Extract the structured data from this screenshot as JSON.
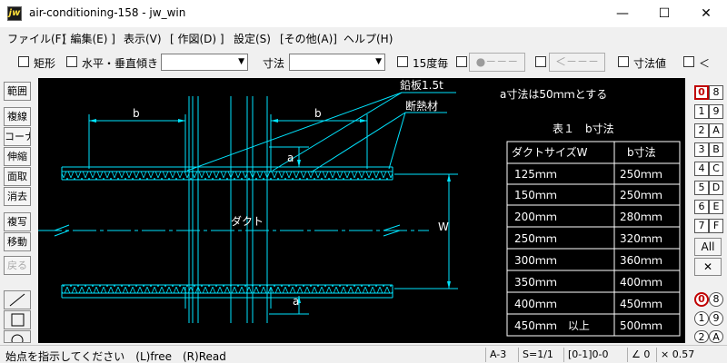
{
  "window": {
    "app_icon": "jw",
    "title": "air-conditioning-158 - jw_win",
    "minimize": "—",
    "maximize": "☐",
    "close": "✕"
  },
  "menu": [
    "ファイル(F)",
    "[ 編集(E) ]",
    "表示(V)",
    "[ 作図(D) ]",
    "設定(S)",
    "[その他(A)]",
    "ヘルプ(H)"
  ],
  "toolbar": {
    "rect": "矩形",
    "hv": "水平・垂直",
    "tilt": "傾き",
    "tilt_value": "",
    "dim": "寸法",
    "dim_value": "",
    "deg15": "15度毎",
    "pt_btn": "●－－－",
    "arrow_btn": "＜－－－",
    "dimval": "寸法値",
    "lt": "＜"
  },
  "left_tools": {
    "items": [
      "範囲",
      "複線",
      "コーナー",
      "伸縮",
      "面取",
      "消去",
      "複写",
      "移動",
      "戻る"
    ],
    "line_icon": "diagonal-line-icon",
    "rect_icon": "rectangle-icon",
    "circle_icon": "circle-icon"
  },
  "layers": {
    "rows": [
      [
        "0",
        "8"
      ],
      [
        "1",
        "9"
      ],
      [
        "2",
        "A"
      ],
      [
        "3",
        "B"
      ],
      [
        "4",
        "C"
      ],
      [
        "5",
        "D"
      ],
      [
        "6",
        "E"
      ],
      [
        "7",
        "F"
      ]
    ],
    "all": "All",
    "x": "✕",
    "groups": [
      [
        "0",
        "8"
      ],
      [
        "1",
        "9"
      ],
      [
        "2",
        "A"
      ]
    ]
  },
  "drawing": {
    "label_lead": "鉛板1.5t",
    "label_insul": "断熱材",
    "note": "a寸法は50ｍｍとする",
    "dim_b1": "b",
    "dim_b2": "b",
    "dim_a1": "a",
    "dim_a2": "a",
    "dim_w": "W",
    "duct": "ダクト"
  },
  "table": {
    "title": "表１　b寸法",
    "headers": [
      "ダクトサイズW",
      "b寸法"
    ],
    "rows": [
      [
        "125ｍｍ",
        "250ｍｍ"
      ],
      [
        "150ｍｍ",
        "250ｍｍ"
      ],
      [
        "200ｍｍ",
        "280ｍｍ"
      ],
      [
        "250ｍｍ",
        "320ｍｍ"
      ],
      [
        "300ｍｍ",
        "360ｍｍ"
      ],
      [
        "350ｍｍ",
        "400ｍｍ"
      ],
      [
        "400ｍｍ",
        "450ｍｍ"
      ],
      [
        "450ｍｍ　以上",
        "500ｍｍ"
      ]
    ]
  },
  "status": {
    "message": "始点を指示してください　(L)free　(R)Read",
    "paper": "A-3",
    "scale": "S=1/1",
    "layer": "[0-1]0-0",
    "angle": "∠ 0",
    "mult": "× 0.57"
  },
  "colors": {
    "canvas_bg": "#000000",
    "drawing_cyan": "#00e5ff",
    "text_white": "#ffffff",
    "active_layer_red": "#c00000"
  }
}
